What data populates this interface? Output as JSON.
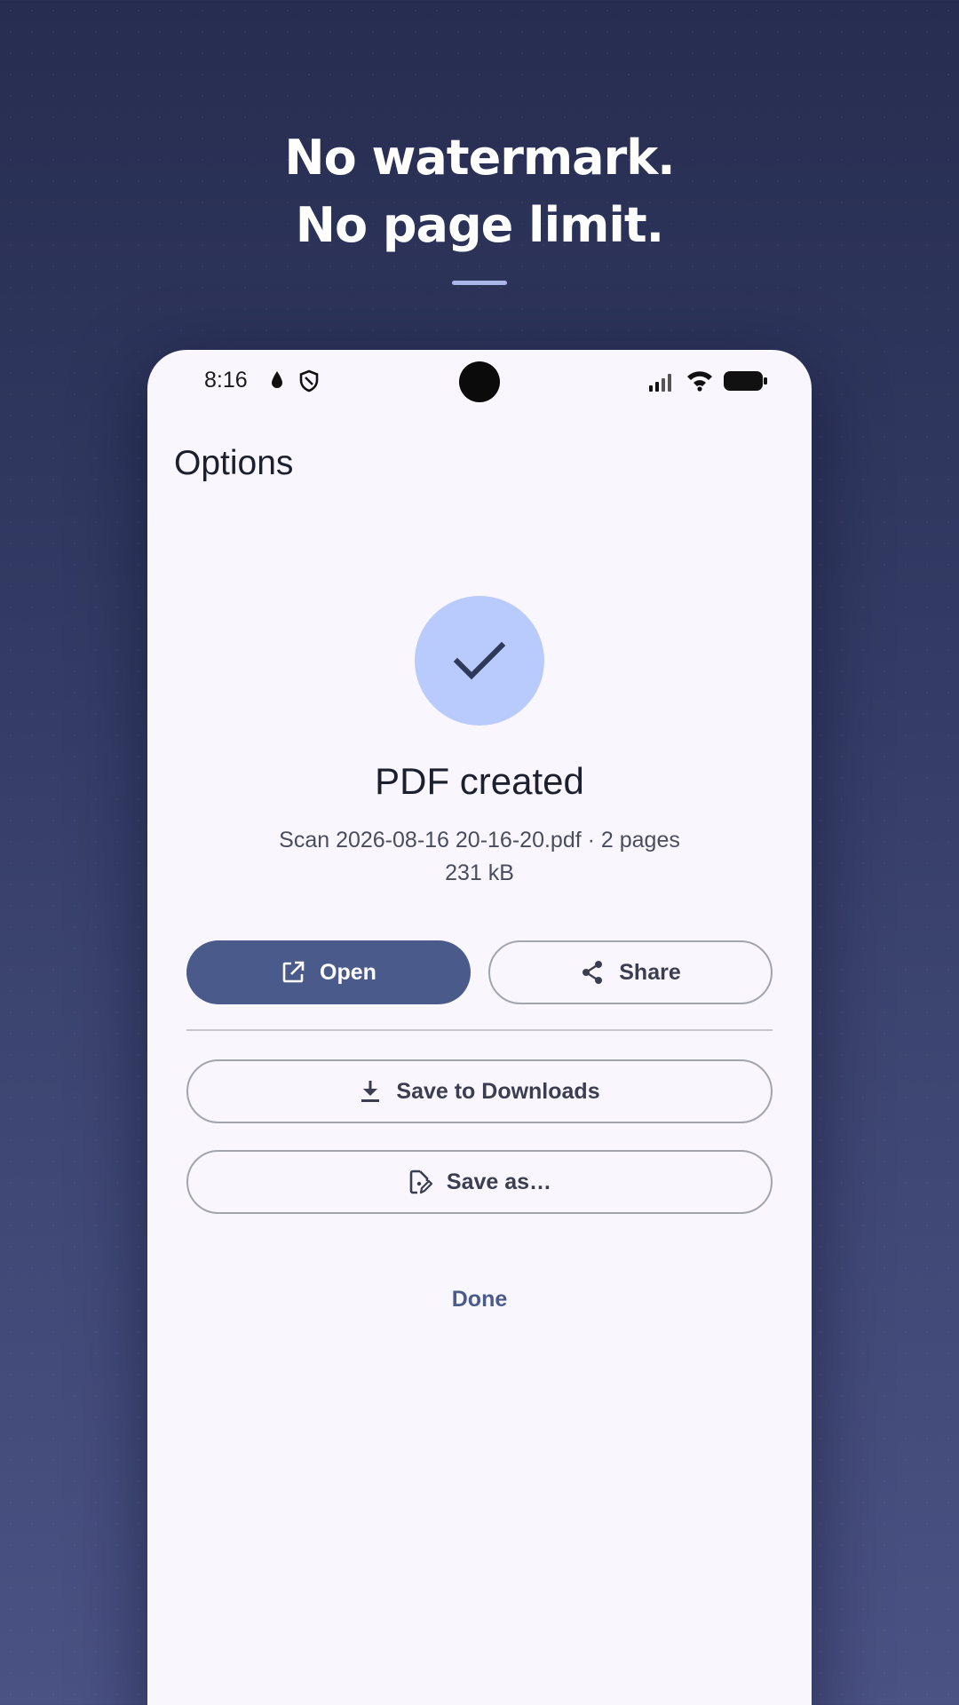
{
  "promo": {
    "line1": "No watermark.",
    "line2": "No page limit."
  },
  "status_bar": {
    "time": "8:16",
    "icons": [
      "drop-icon",
      "shield-icon",
      "signal-icon",
      "wifi-icon",
      "battery-icon"
    ]
  },
  "app_bar": {
    "title": "Options"
  },
  "result": {
    "icon": "check-icon",
    "title": "PDF created",
    "file_line": "Scan 2026-08-16 20-16-20.pdf · 2 pages",
    "size_line": "231 kB"
  },
  "actions": {
    "open_label": "Open",
    "share_label": "Share",
    "save_downloads_label": "Save to Downloads",
    "save_as_label": "Save as…",
    "done_label": "Done"
  },
  "colors": {
    "primary": "#4a5b8b",
    "check_bg": "#b9cbfc",
    "surface": "#f9f7fd"
  }
}
